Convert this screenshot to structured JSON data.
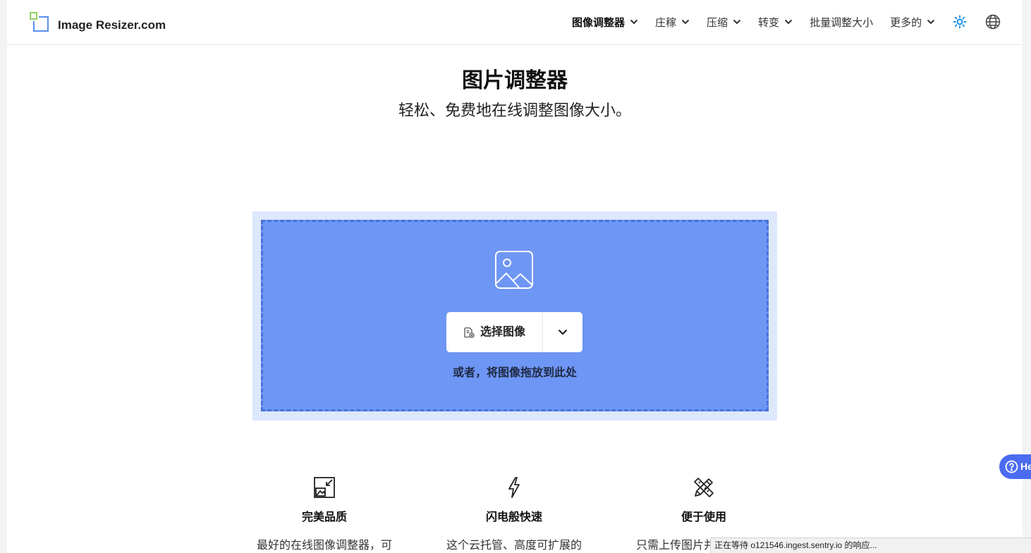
{
  "header": {
    "logo": {
      "text": "Image Resizer.com",
      "icon": "logo-squares-icon"
    },
    "nav": [
      {
        "label": "图像调整器",
        "icon": "chevron-down-icon",
        "active": true
      },
      {
        "label": "庄稼",
        "icon": "chevron-down-icon"
      },
      {
        "label": "压缩",
        "icon": "chevron-down-icon"
      },
      {
        "label": "转变",
        "icon": "chevron-down-icon"
      },
      {
        "label": "批量调整大小"
      },
      {
        "label": "更多的",
        "icon": "chevron-down-icon"
      }
    ],
    "theme_toggle_icon": "sun-icon",
    "language_icon": "globe-icon"
  },
  "hero": {
    "title": "图片调整器",
    "subtitle": "轻松、免费地在线调整图像大小。"
  },
  "upload": {
    "icon": "image-icon",
    "select_button": {
      "icon": "file-add-icon",
      "label": "选择图像"
    },
    "more_sources_icon": "chevron-down-icon",
    "drop_hint": "或者，将图像拖放到此处"
  },
  "features": [
    {
      "icon": "resize-image-icon",
      "title": "完美品质",
      "description": "最好的在线图像调整器，可"
    },
    {
      "icon": "lightning-icon",
      "title": "闪电般快速",
      "description": "这个云托管、高度可扩展的"
    },
    {
      "icon": "pencil-ruler-icon",
      "title": "便于使用",
      "description": "只需上传图片并"
    }
  ],
  "help_button": {
    "icon": "question-circle-icon",
    "label": "He"
  },
  "status_bar": {
    "text": "正在等待 o121546.ingest.sentry.io 的响应..."
  },
  "colors": {
    "dropzone_fill": "#6e96f4",
    "dropzone_border": "#4a72dc",
    "dropzone_outer": "#dde8fc",
    "theme_icon": "#1a8fe6",
    "help_button": "#4b6cf0",
    "logo_green": "#8fd35c",
    "logo_blue": "#5c8ff0"
  }
}
